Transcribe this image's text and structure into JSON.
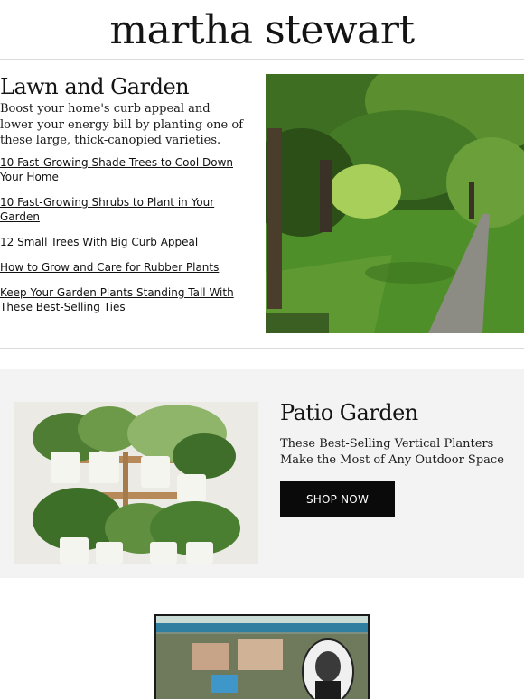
{
  "header": {
    "logo": "martha stewart"
  },
  "lawn": {
    "title": "Lawn and Garden",
    "description": "Boost your home's curb appeal and lower your energy bill by planting one of these large, thick-canopied varieties.",
    "links": [
      "10 Fast-Growing Shade Trees to Cool Down Your Home",
      "10 Fast-Growing Shrubs to Plant in Your Garden",
      "12 Small Trees With Big Curb Appeal",
      "How to Grow and Care for Rubber Plants",
      "Keep Your Garden Plants Standing Tall With These Best-Selling Ties"
    ]
  },
  "patio": {
    "title": "Patio Garden",
    "description": "These Best-Selling Vertical Planters Make the Most of Any Outdoor Space",
    "button": "SHOP NOW"
  },
  "colors": {
    "background": "#ffffff",
    "patio_background": "#f3f3f3",
    "button": "#0a0a0a",
    "button_text": "#ffffff",
    "divider": "#d9d9d9"
  }
}
